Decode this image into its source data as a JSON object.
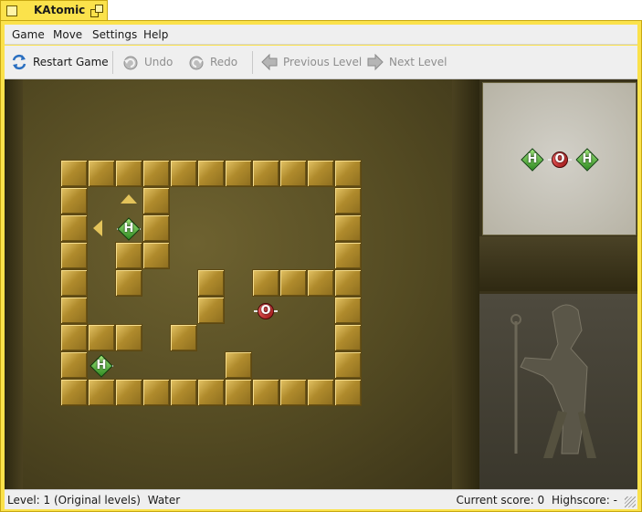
{
  "window": {
    "title": "KAtomic"
  },
  "menu": [
    "Game",
    "Move",
    "Settings",
    "Help"
  ],
  "toolbar": {
    "restart": "Restart Game",
    "undo": "Undo",
    "redo": "Redo",
    "prev": "Previous Level",
    "next": "Next Level"
  },
  "status": {
    "level": "Level: 1 (Original levels)",
    "molecule": "Water",
    "score": "Current score: 0",
    "highscore": "Highscore: -"
  },
  "atoms": {
    "h": "H",
    "o": "O"
  },
  "icons": [
    "restart-icon",
    "undo-icon",
    "redo-icon",
    "arrow-left-icon",
    "arrow-right-icon"
  ],
  "colors": {
    "accent": "#fbe24b",
    "wall": "#b08b2c",
    "hydrogen": "#2f8a22",
    "oxygen": "#9a1414"
  }
}
